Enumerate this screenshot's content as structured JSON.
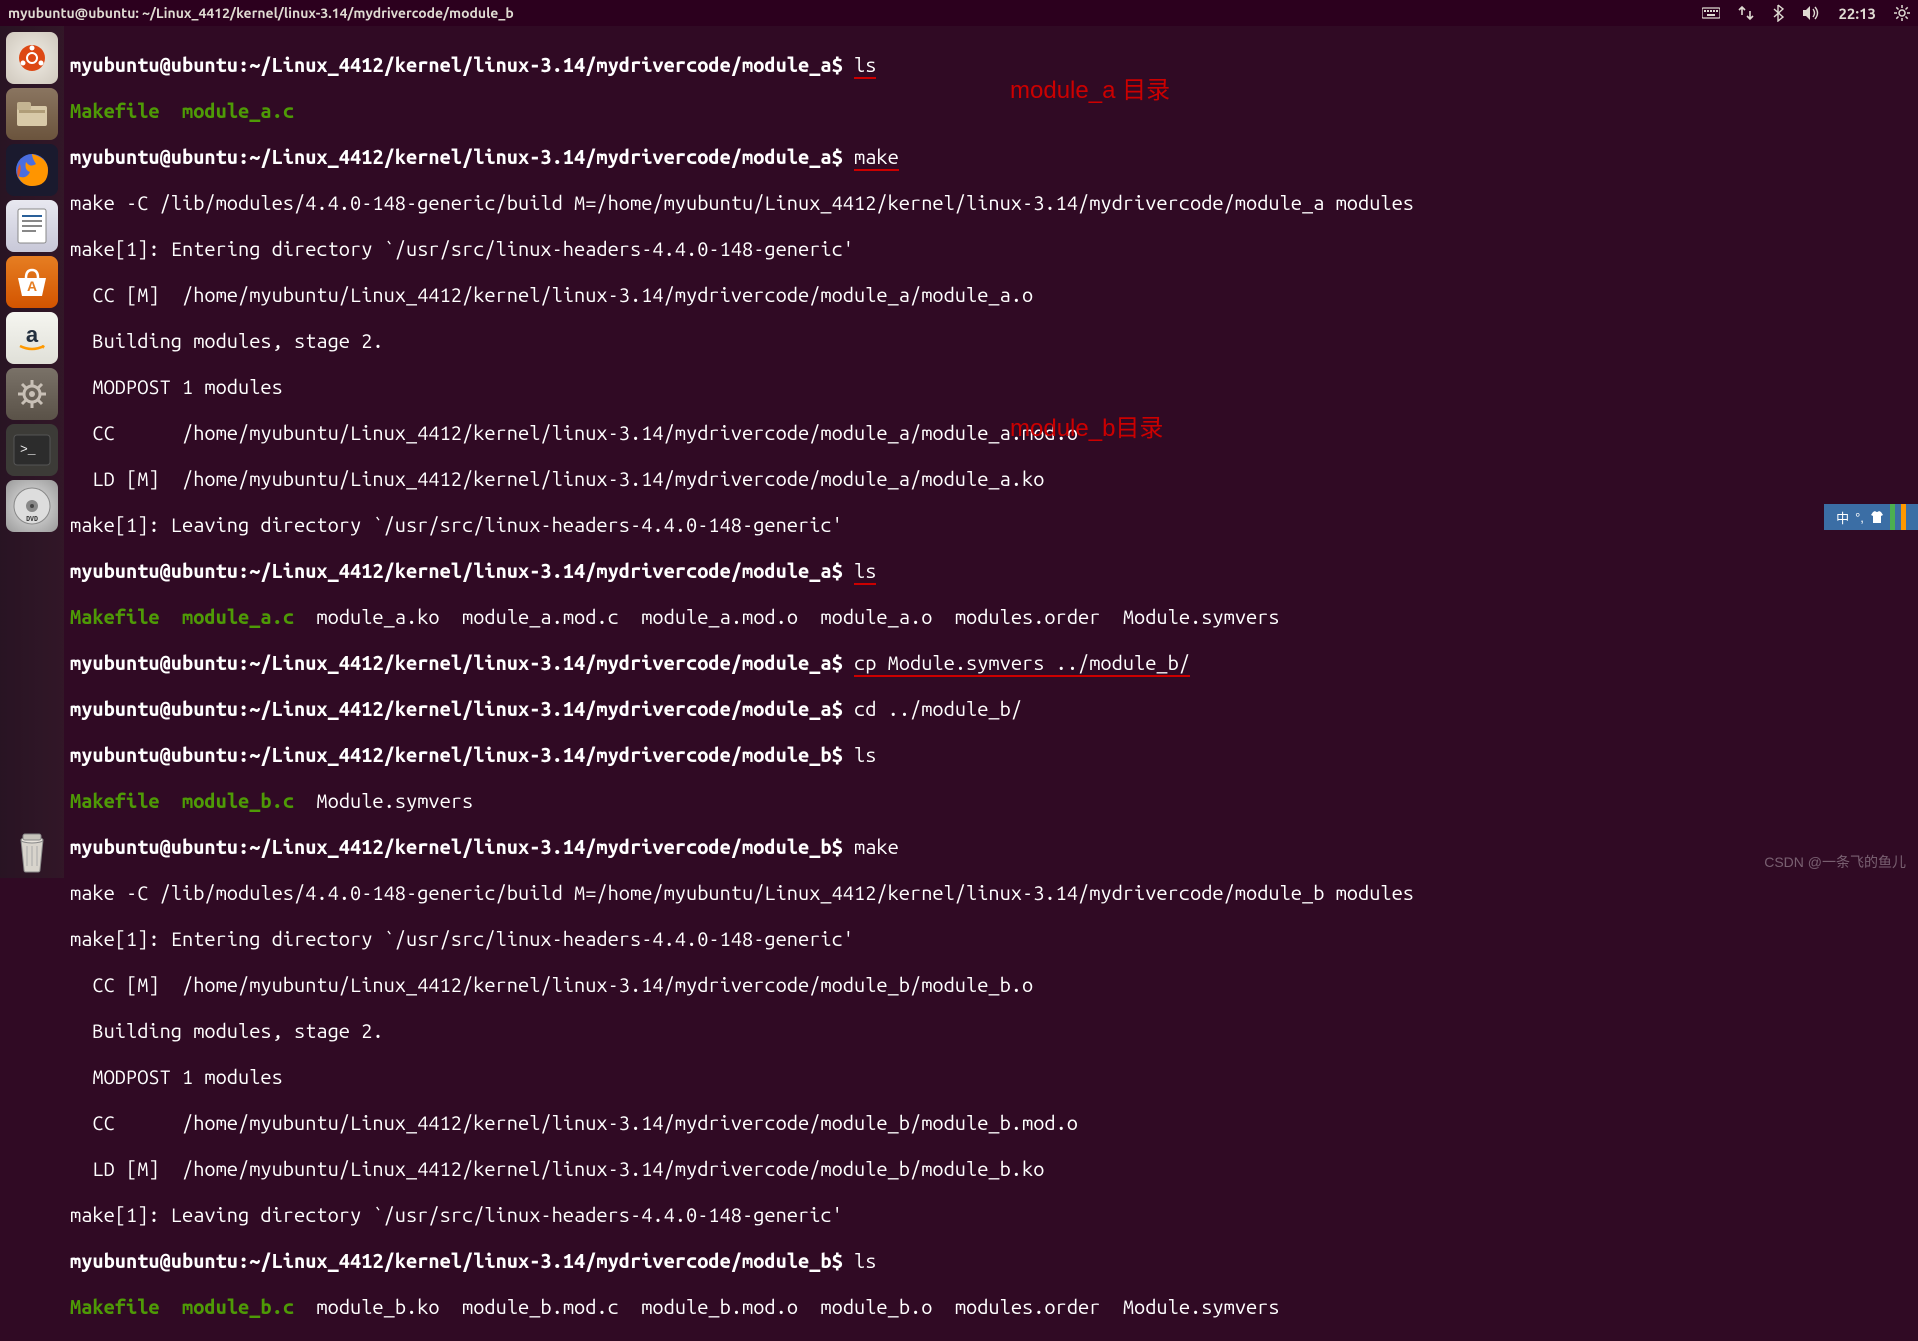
{
  "panel": {
    "title": "myubuntu@ubuntu: ~/Linux_4412/kernel/linux-3.14/mydrivercode/module_b",
    "time": "22:13"
  },
  "launcher": {
    "items": [
      "ubuntu-dash",
      "files",
      "firefox",
      "libreoffice-writer",
      "ubuntu-software",
      "amazon",
      "settings",
      "terminal",
      "media-disc"
    ],
    "bottom": "trash"
  },
  "annotations": {
    "a": "module_a 目录",
    "b": "module_b目录"
  },
  "prompts": {
    "user_host": "myubuntu@ubuntu",
    "path_a": "~/Linux_4412/kernel/linux-3.14/mydrivercode/module_a",
    "path_b": "~/Linux_4412/kernel/linux-3.14/mydrivercode/module_b"
  },
  "commands": {
    "ls": "ls",
    "make": "make",
    "cp": "cp Module.symvers ../module_b/",
    "cd": "cd ../module_b/"
  },
  "output": {
    "ls_a_initial_makefile": "Makefile",
    "ls_a_initial_src": "module_a.c",
    "make_a_line1": "make -C /lib/modules/4.4.0-148-generic/build M=/home/myubuntu/Linux_4412/kernel/linux-3.14/mydrivercode/module_a modules",
    "make_a_enter": "make[1]: Entering directory `/usr/src/linux-headers-4.4.0-148-generic'",
    "make_a_cc_o": "  CC [M]  /home/myubuntu/Linux_4412/kernel/linux-3.14/mydrivercode/module_a/module_a.o",
    "make_a_stage2": "  Building modules, stage 2.",
    "make_a_modpost": "  MODPOST 1 modules",
    "make_a_cc_mod": "  CC      /home/myubuntu/Linux_4412/kernel/linux-3.14/mydrivercode/module_a/module_a.mod.o",
    "make_a_ld": "  LD [M]  /home/myubuntu/Linux_4412/kernel/linux-3.14/mydrivercode/module_a/module_a.ko",
    "make_a_leave": "make[1]: Leaving directory `/usr/src/linux-headers-4.4.0-148-generic'",
    "ls_a_after_rest": "  module_a.ko  module_a.mod.c  module_a.mod.o  module_a.o  modules.order  Module.symvers",
    "ls_b_initial_makefile": "Makefile",
    "ls_b_initial_src": "module_b.c",
    "ls_b_initial_symvers": "  Module.symvers",
    "make_b_line1": "make -C /lib/modules/4.4.0-148-generic/build M=/home/myubuntu/Linux_4412/kernel/linux-3.14/mydrivercode/module_b modules",
    "make_b_enter": "make[1]: Entering directory `/usr/src/linux-headers-4.4.0-148-generic'",
    "make_b_cc_o": "  CC [M]  /home/myubuntu/Linux_4412/kernel/linux-3.14/mydrivercode/module_b/module_b.o",
    "make_b_stage2": "  Building modules, stage 2.",
    "make_b_modpost": "  MODPOST 1 modules",
    "make_b_cc_mod": "  CC      /home/myubuntu/Linux_4412/kernel/linux-3.14/mydrivercode/module_b/module_b.mod.o",
    "make_b_ld": "  LD [M]  /home/myubuntu/Linux_4412/kernel/linux-3.14/mydrivercode/module_b/module_b.ko",
    "make_b_leave": "make[1]: Leaving directory `/usr/src/linux-headers-4.4.0-148-generic'",
    "ls_b_after_rest": "  module_b.ko  module_b.mod.c  module_b.mod.o  module_b.o  modules.order  Module.symvers"
  },
  "ime": {
    "label": "中",
    "sym": "°,"
  },
  "watermark": "CSDN @一条飞的鱼儿"
}
